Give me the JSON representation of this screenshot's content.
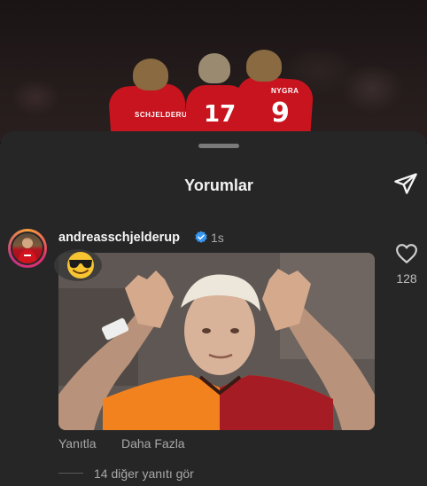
{
  "header": {
    "title": "Yorumlar",
    "share_icon": "paper-plane-icon"
  },
  "background_photo": {
    "jersey_numbers": [
      "17",
      "9"
    ],
    "jersey_names": [
      "SCHJELDERUP",
      "NYGRA"
    ]
  },
  "comment": {
    "username": "andreasschjelderup",
    "verified": true,
    "time": "1s",
    "emoji": "😎",
    "media": "gif",
    "like_icon": "heart-outline-icon",
    "like_count": "128",
    "reply_label": "Yanıtla",
    "more_label": "Daha Fazla",
    "view_replies_label": "14 diğer yanıtı gör"
  },
  "colors": {
    "sheet_bg": "#262626",
    "verified_blue": "#3897f0",
    "secondary_text": "#a8a8a8"
  }
}
